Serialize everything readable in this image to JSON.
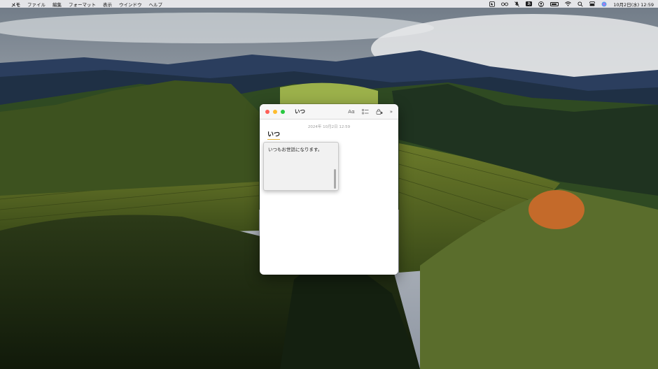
{
  "menubar": {
    "app_name": "メモ",
    "items": [
      "ファイル",
      "編集",
      "フォーマット",
      "表示",
      "ウインドウ",
      "ヘルプ"
    ],
    "clock": "10月2日(水) 12:59",
    "input_badge": "あ"
  },
  "note_window": {
    "title": "いつ",
    "toolbar": {
      "format_label": "Aα",
      "more_label": "»"
    },
    "date": "2024年 10月2日 12:59",
    "heading": "いつ"
  },
  "ime": {
    "candidate": "いつもお世話になります。"
  },
  "colors": {
    "close": "#fe5f57",
    "minimize": "#febc2e",
    "zoom": "#28c840",
    "heading_underline": "#e8b33c"
  }
}
